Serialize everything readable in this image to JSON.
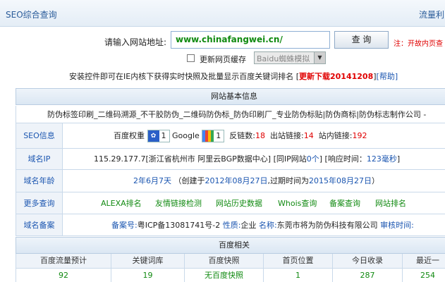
{
  "header": {
    "title": "SEO综合查询",
    "right_text": "流量利"
  },
  "search": {
    "label": "请输入网站地址:",
    "value": "www.chinafangwei.cn/",
    "button": "查 询",
    "note": "注：开故内页查"
  },
  "options": {
    "refresh_label": "更新网页缓存",
    "spider_select": "Baidu蜘蛛模拟"
  },
  "install": {
    "text": "安装控件即可在IE内核下获得实时快照及批量显示百度关键词排名",
    "bracket_open": "[",
    "download": "更新下载20141208",
    "bracket_close": "]",
    "help": "[帮助]"
  },
  "basic": {
    "header": "网站基本信息",
    "site_title": "防伪标签印刷_二维码溯源_不干胶防伪_二维码防伪标_防伪印刷厂_专业防伪标贴|防伪商标|防伪标志制作公司 -",
    "seo": {
      "key": "SEO信息",
      "baidu_label": "百度权重",
      "baidu_value": "1",
      "google_label": "Google",
      "google_value": "1",
      "backlinks_label": "反链数:",
      "backlinks_value": "18",
      "outlinks_label": "出站链接:",
      "outlinks_value": "14",
      "inlinks_label": "站内链接:",
      "inlinks_value": "192"
    },
    "ip": {
      "key": "域名IP",
      "text": "115.29.177.7[浙江省杭州市 阿里云BGP数据中心]",
      "sameip_prefix": "[同IP网站",
      "sameip_value": "0个",
      "sameip_suffix": "]",
      "resp_prefix": "[响应时间：",
      "resp_value": "123毫秒",
      "resp_suffix": "]"
    },
    "age": {
      "key": "域名年龄",
      "age_value": "2年6月7天",
      "created_prefix": "（创建于",
      "created": "2012年08月27日",
      "expire_prefix": ",过期时间为",
      "expire": "2015年08月27日",
      "suffix": "）"
    },
    "more": {
      "key": "更多查询",
      "links": [
        "ALEXA排名",
        "友情链接检测",
        "网站历史数据",
        "Whois查询",
        "备案查询",
        "网站排名"
      ]
    },
    "beian": {
      "key": "域名备案",
      "num_label": "备案号:",
      "num": "粤ICP备13081741号-2",
      "nature_label": "性质:",
      "nature": "企业",
      "name_label": "名称:",
      "name": "东莞市将为防伪科技有限公司",
      "audit_label": "审核时间:"
    }
  },
  "baidu": {
    "header": "百度相关",
    "columns": [
      "百度流量预计",
      "关键词库",
      "百度快照",
      "首页位置",
      "今日收录",
      "最近一"
    ],
    "values": [
      "92",
      "19",
      "无百度快照",
      "1",
      "287",
      "254"
    ]
  }
}
